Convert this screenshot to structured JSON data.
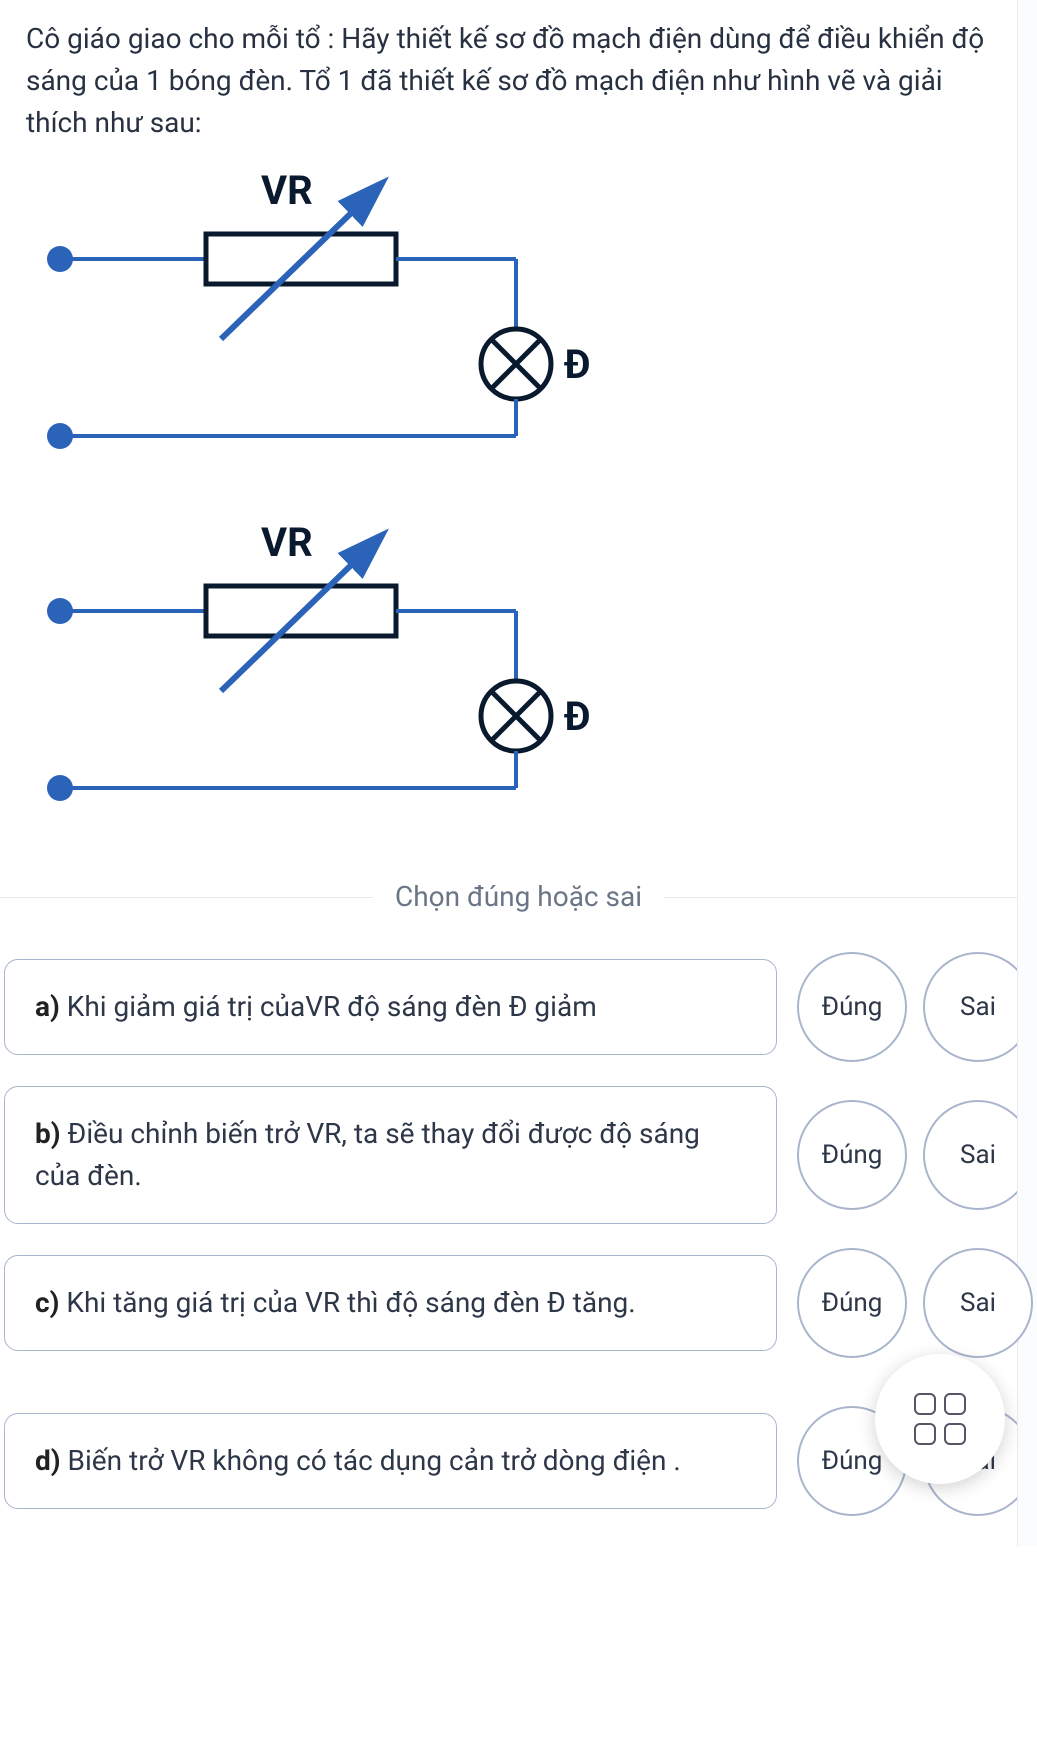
{
  "question": {
    "text": "Cô giáo giao cho mỗi tổ : Hãy thiết kế sơ đồ mạch điện dùng để điều khiển độ sáng của 1 bóng đèn. Tổ 1 đã thiết kế sơ đồ mạch điện như hình vẽ và giải thích như sau:"
  },
  "diagrams": [
    {
      "vr_label": "VR",
      "bulb_label": "Đ"
    },
    {
      "vr_label": "VR",
      "bulb_label": "Đ"
    }
  ],
  "divider_label": "Chọn đúng hoặc sai",
  "buttons": {
    "true_label": "Đúng",
    "false_label": "Sai"
  },
  "options": [
    {
      "key": "a)",
      "text": "Khi giảm giá trị củaVR độ sáng đèn Đ giảm"
    },
    {
      "key": "b)",
      "text": "Điều chỉnh biến trở VR, ta sẽ thay đổi được độ sáng của đèn."
    },
    {
      "key": "c)",
      "text": "Khi tăng giá trị của VR thì độ sáng đèn Đ tăng."
    },
    {
      "key": "d)",
      "text": "Biến trở VR không có tác dụng cản trở dòng điện ."
    }
  ],
  "fab_name": "grid-menu"
}
